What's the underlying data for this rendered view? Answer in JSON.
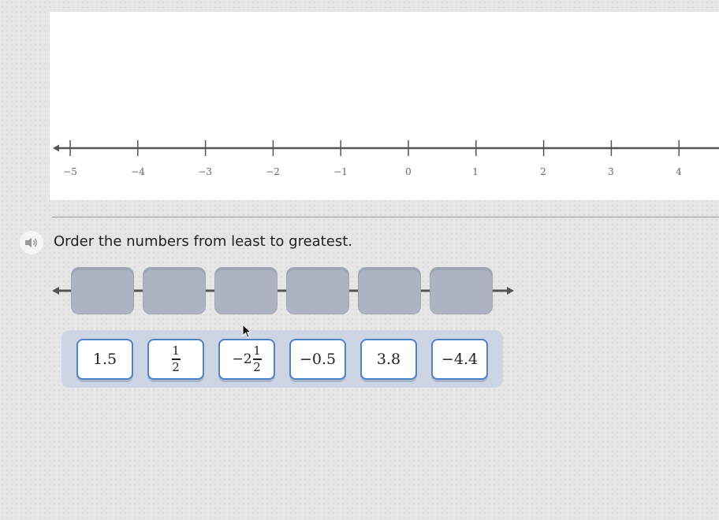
{
  "number_line": {
    "labels": [
      "−5",
      "−4",
      "−3",
      "−2",
      "−1",
      "0",
      "1",
      "2",
      "3",
      "4"
    ]
  },
  "question": {
    "prompt": "Order the numbers from least to greatest."
  },
  "answer_slots": 6,
  "tiles": [
    {
      "id": "tile-1-5",
      "text": "1.5"
    },
    {
      "id": "tile-half",
      "frac_num": "1",
      "frac_den": "2"
    },
    {
      "id": "tile-neg-two-and-half",
      "whole": "−2",
      "frac_num": "1",
      "frac_den": "2"
    },
    {
      "id": "tile-neg-0-5",
      "text": "−0.5"
    },
    {
      "id": "tile-3-8",
      "text": "3.8"
    },
    {
      "id": "tile-neg-4-4",
      "text": "−4.4"
    }
  ],
  "icons": {
    "speaker": "speaker-icon",
    "cursor": "mouse-pointer-icon"
  },
  "colors": {
    "tile_border": "#4e84c4",
    "slot_fill": "#adb3c3",
    "tray_fill": "#cdd5e5"
  }
}
